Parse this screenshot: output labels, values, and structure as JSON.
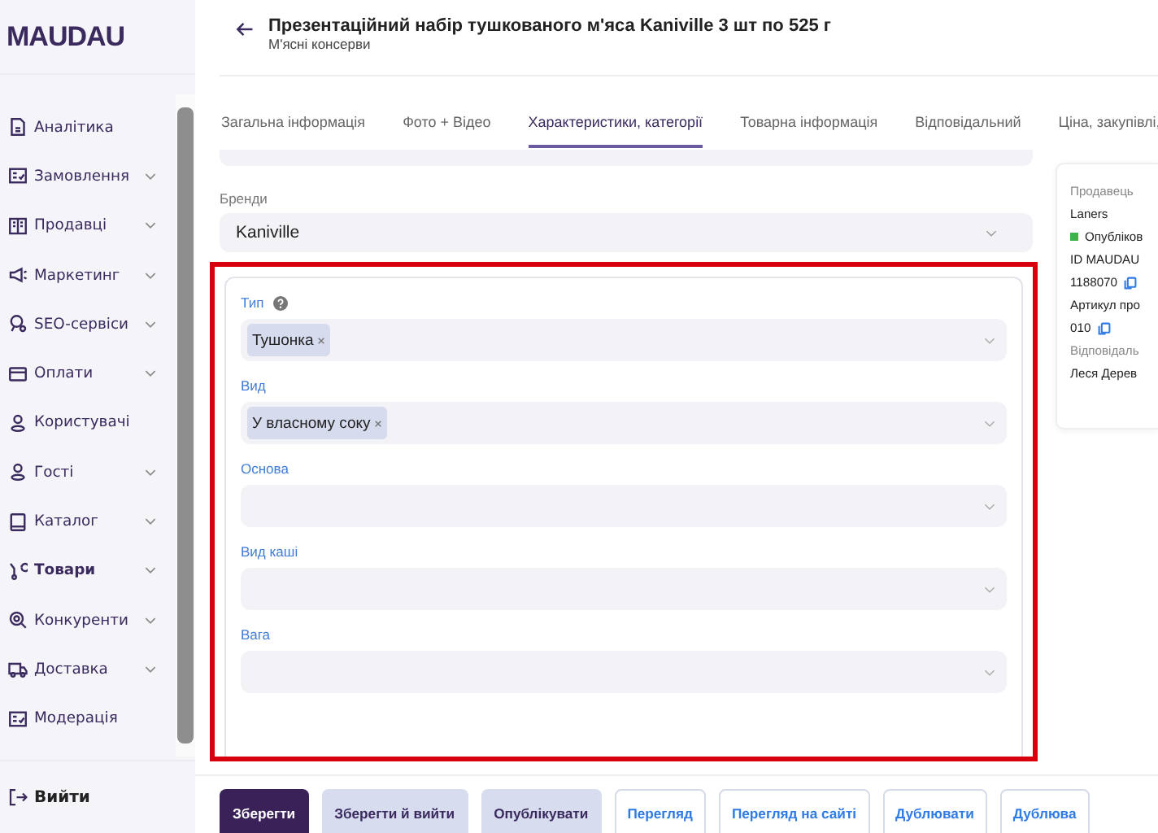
{
  "logo": "MAUDAU",
  "sidebar": {
    "items": [
      {
        "label": "Аналітика",
        "expandable": false,
        "selected": false
      },
      {
        "label": "Замовлення",
        "expandable": true,
        "selected": false
      },
      {
        "label": "Продавці",
        "expandable": true,
        "selected": false
      },
      {
        "label": "Маркетинг",
        "expandable": true,
        "selected": false
      },
      {
        "label": "SEO-сервіси",
        "expandable": true,
        "selected": false
      },
      {
        "label": "Оплати",
        "expandable": true,
        "selected": false
      },
      {
        "label": "Користувачі",
        "expandable": false,
        "selected": false
      },
      {
        "label": "Гості",
        "expandable": true,
        "selected": false
      },
      {
        "label": "Каталог",
        "expandable": true,
        "selected": false
      },
      {
        "label": "Товари",
        "expandable": true,
        "selected": true
      },
      {
        "label": "Конкуренти",
        "expandable": true,
        "selected": false
      },
      {
        "label": "Доставка",
        "expandable": true,
        "selected": false
      },
      {
        "label": "Модерація",
        "expandable": false,
        "selected": false
      }
    ],
    "logout": "Вийти"
  },
  "header": {
    "title": "Презентаційний набір тушкованого м'яса Kaniville 3 шт по 525 г",
    "subtitle": "М'ясні консерви"
  },
  "tabs": [
    {
      "label": "Загальна інформація",
      "selected": false
    },
    {
      "label": "Фото + Відео",
      "selected": false
    },
    {
      "label": "Характеристики, категорії",
      "selected": true
    },
    {
      "label": "Товарна інформація",
      "selected": false
    },
    {
      "label": "Відповідальний",
      "selected": false
    },
    {
      "label": "Ціна, закупівлі,",
      "selected": false
    }
  ],
  "brand": {
    "label": "Бренди",
    "value": "Kaniville"
  },
  "attributes": [
    {
      "label": "Тип",
      "help": true,
      "tags": [
        "Тушонка"
      ]
    },
    {
      "label": "Вид",
      "help": false,
      "tags": [
        "У власному соку"
      ]
    },
    {
      "label": "Основа",
      "help": false
    },
    {
      "label": "Вид каші",
      "help": false
    },
    {
      "label": "Вага",
      "help": false
    }
  ],
  "info_card": {
    "seller_label": "Продавець",
    "seller": "Laners",
    "status": "Опубліков",
    "id_label": "ID MAUDAU",
    "id": "1188070",
    "sku_label": "Артикул про",
    "sku": "010",
    "owner_label": "Відповідаль",
    "owner": "Леся Дерев"
  },
  "buttons": [
    {
      "label": "Зберегти",
      "kind": "primary"
    },
    {
      "label": "Зберегти й вийти",
      "kind": "secondary"
    },
    {
      "label": "Опублікувати",
      "kind": "secondary"
    },
    {
      "label": "Перегляд",
      "kind": "outline"
    },
    {
      "label": "Перегляд на сайті",
      "kind": "outline"
    },
    {
      "label": "Дублювати",
      "kind": "outline"
    },
    {
      "label": "Дублюва",
      "kind": "outline"
    }
  ]
}
